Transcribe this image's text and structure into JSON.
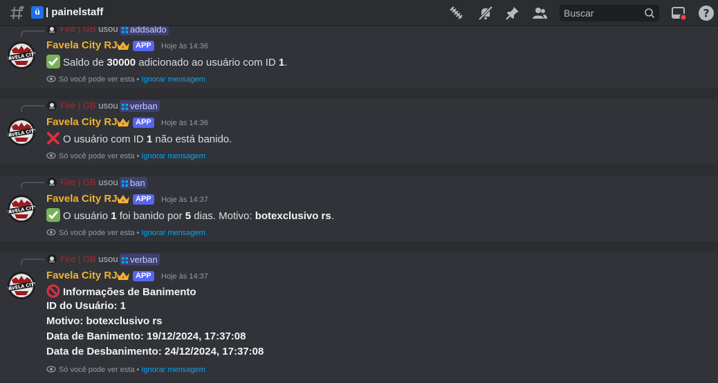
{
  "header": {
    "channel_badge": "ŭ",
    "separator": "|",
    "channel_name": "painelstaff",
    "search_placeholder": "Buscar",
    "icons": [
      "threads-icon",
      "mute-icon",
      "pin-icon",
      "members-icon",
      "search-icon",
      "inbox-icon",
      "help-icon"
    ]
  },
  "colors": {
    "bg": "#313338",
    "header_bg": "#2b2d31",
    "author": "#f0b232",
    "reply_user": "#a8282e",
    "app_badge": "#5865f2",
    "link": "#00a8fc"
  },
  "messages": [
    {
      "reply_user": "Fire | GB",
      "reply_used": "usou",
      "command": "addsaldo",
      "author": "Favela City RJ",
      "badge": "APP",
      "timestamp": "Hoje às 14:36",
      "emoji": "check",
      "line": {
        "p1": "Saldo de ",
        "b1": "30000",
        "p2": " adicionado ao usuário com ID ",
        "b2": "1",
        "p3": "."
      },
      "ephemeral": "Só você pode ver esta •",
      "dismiss": "Ignorar mensagem"
    },
    {
      "reply_user": "Fire | GB",
      "reply_used": "usou",
      "command": "verban",
      "author": "Favela City RJ",
      "badge": "APP",
      "timestamp": "Hoje às 14:36",
      "emoji": "cross",
      "line": {
        "p1": "O usuário com ID ",
        "b1": "1",
        "p2": " não está banido."
      },
      "ephemeral": "Só você pode ver esta •",
      "dismiss": "Ignorar mensagem"
    },
    {
      "reply_user": "Fire | GB",
      "reply_used": "usou",
      "command": "ban",
      "author": "Favela City RJ",
      "badge": "APP",
      "timestamp": "Hoje às 14:37",
      "emoji": "check",
      "line": {
        "p1": "O usuário ",
        "b1": "1",
        "p2": " foi banido por ",
        "b2": "5",
        "p3": " dias. Motivo: ",
        "b3": "botexclusivo rs",
        "p4": "."
      },
      "ephemeral": "Só você pode ver esta •",
      "dismiss": "Ignorar mensagem"
    },
    {
      "reply_user": "Fire | GB",
      "reply_used": "usou",
      "command": "verban",
      "author": "Favela City RJ",
      "badge": "APP",
      "timestamp": "Hoje às 14:37",
      "emoji": "prohibited",
      "title": "Informações de Banimento",
      "fields": [
        "ID do Usuário: 1",
        "Motivo: botexclusivo rs",
        "Data de Banimento: 19/12/2024, 17:37:08",
        "Data de Desbanimento: 24/12/2024, 17:37:08"
      ],
      "ephemeral": "Só você pode ver esta •",
      "dismiss": "Ignorar mensagem"
    }
  ]
}
